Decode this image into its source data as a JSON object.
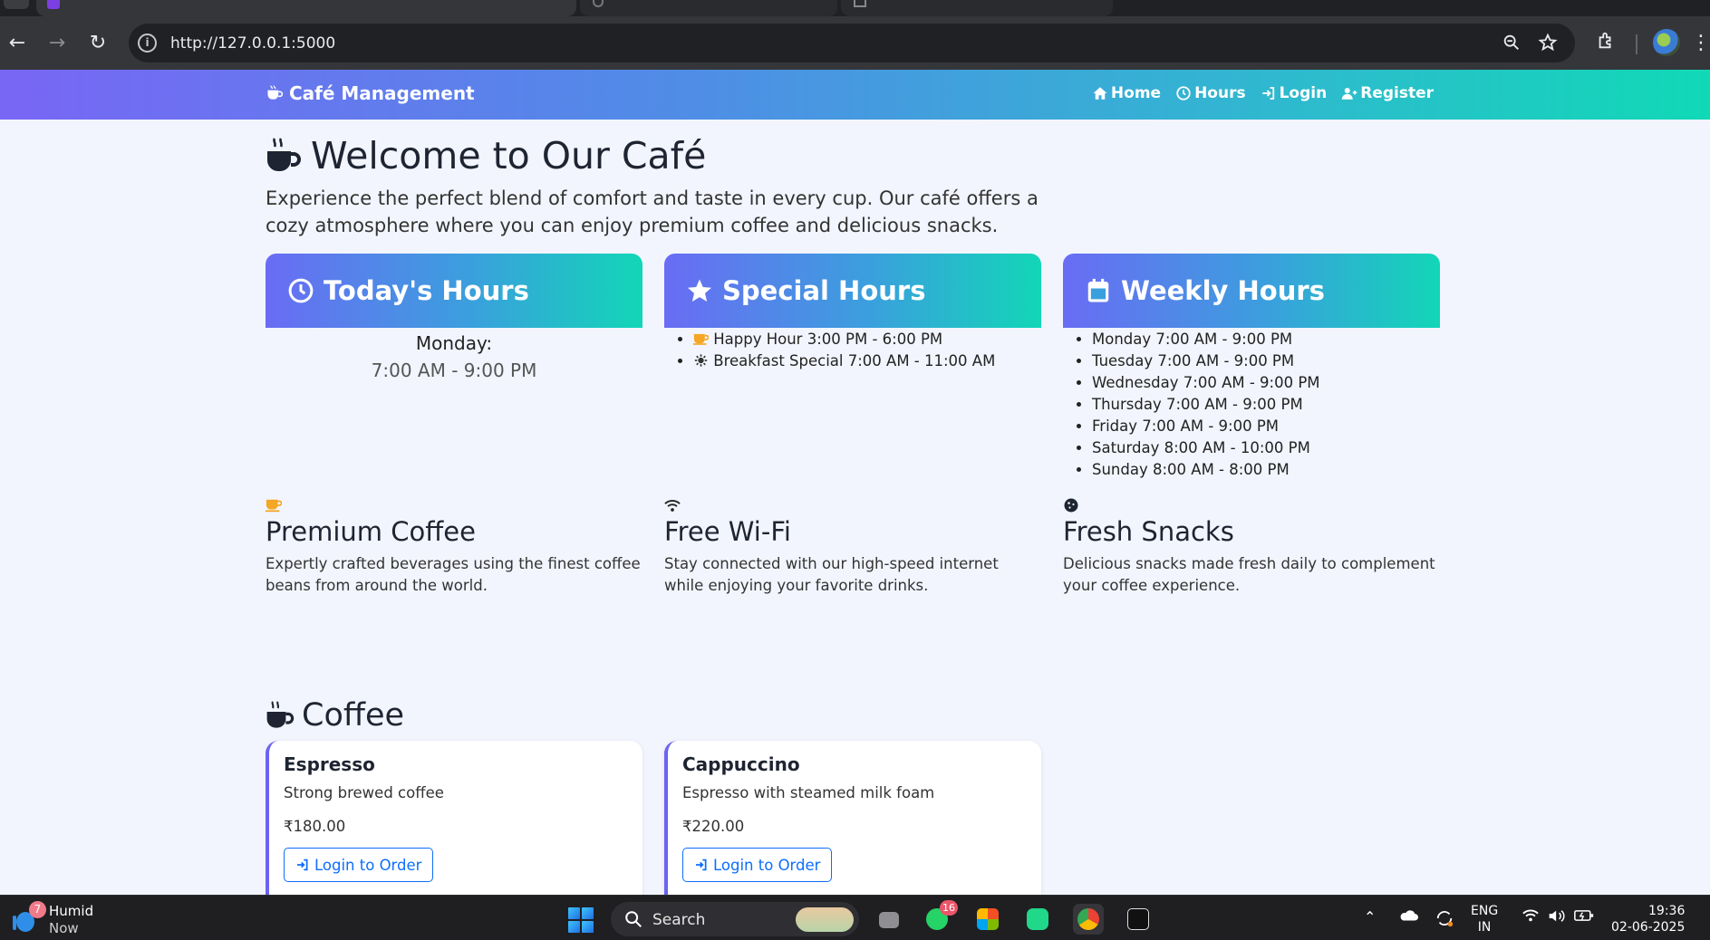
{
  "browser": {
    "url": "http://127.0.0.1:5000"
  },
  "navbar": {
    "brand": "Café Management",
    "links": [
      {
        "label": "Home"
      },
      {
        "label": "Hours"
      },
      {
        "label": "Login"
      },
      {
        "label": "Register"
      }
    ]
  },
  "welcome": {
    "title": "Welcome to Our Café",
    "intro": "Experience the perfect blend of comfort and taste in every cup. Our café offers a cozy atmosphere where you can enjoy premium coffee and delicious snacks."
  },
  "hours": {
    "today": {
      "title": "Today's Hours",
      "day": "Monday:",
      "time": "7:00 AM - 9:00 PM"
    },
    "special": {
      "title": "Special Hours",
      "items": [
        {
          "icon": "coffee-cup-icon",
          "text": "Happy Hour 3:00 PM - 6:00 PM"
        },
        {
          "icon": "sun-icon",
          "text": "Breakfast Special 7:00 AM - 11:00 AM"
        }
      ]
    },
    "weekly": {
      "title": "Weekly Hours",
      "items": [
        "Monday 7:00 AM - 9:00 PM",
        "Tuesday 7:00 AM - 9:00 PM",
        "Wednesday 7:00 AM - 9:00 PM",
        "Thursday 7:00 AM - 9:00 PM",
        "Friday 7:00 AM - 9:00 PM",
        "Saturday 8:00 AM - 10:00 PM",
        "Sunday 8:00 AM - 8:00 PM"
      ]
    }
  },
  "features": [
    {
      "icon": "coffee-cup-icon",
      "title": "Premium Coffee",
      "text": "Expertly crafted beverages using the finest coffee beans from around the world."
    },
    {
      "icon": "wifi-icon",
      "title": "Free Wi-Fi",
      "text": "Stay connected with our high-speed internet while enjoying your favorite drinks."
    },
    {
      "icon": "cookie-icon",
      "title": "Fresh Snacks",
      "text": "Delicious snacks made fresh daily to complement your coffee experience."
    }
  ],
  "menu": {
    "section_title": "Coffee",
    "items": [
      {
        "name": "Espresso",
        "description": "Strong brewed coffee",
        "price": "₹180.00",
        "button": "Login to Order"
      },
      {
        "name": "Cappuccino",
        "description": "Espresso with steamed milk foam",
        "price": "₹220.00",
        "button": "Login to Order"
      }
    ]
  },
  "colors": {
    "gradient_start": "#7866f5",
    "gradient_end": "#10d9b6",
    "accent_blue": "#0d6efd",
    "card_border": "#6c63f0",
    "coffee_orange": "#f5a623"
  },
  "taskbar": {
    "weather_badge": "7",
    "weather_title": "Humid",
    "weather_sub": "Now",
    "search_label": "Search",
    "whatsapp_badge": "16",
    "lang_line1": "ENG",
    "lang_line2": "IN",
    "time": "19:36",
    "date": "02-06-2025"
  }
}
